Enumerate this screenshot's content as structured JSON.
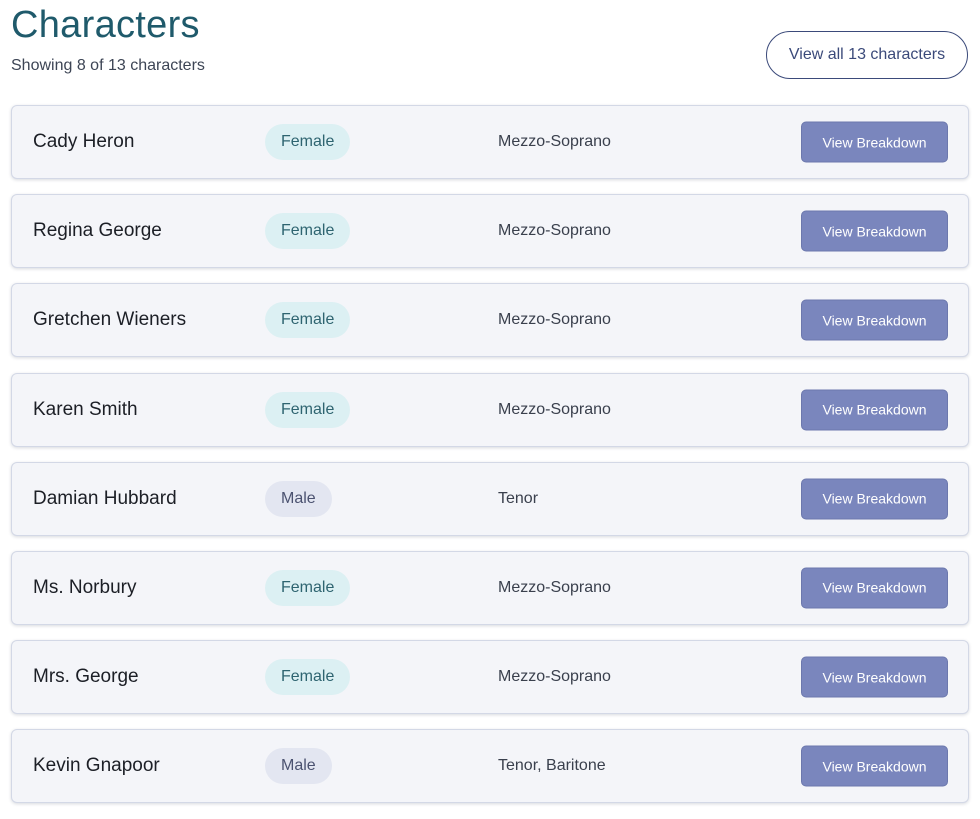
{
  "header": {
    "title": "Characters",
    "subtitle": "Showing 8 of 13 characters",
    "view_all_label": "View all 13 characters"
  },
  "colors": {
    "title": "#1f5a6b",
    "card_background": "#f4f5f9",
    "female_badge_bg": "#dcf0f3",
    "male_badge_bg": "#e3e6f1",
    "breakdown_button_bg": "#7a86bd"
  },
  "characters": [
    {
      "name": "Cady Heron",
      "gender": "Female",
      "voice": "Mezzo-Soprano",
      "action_label": "View Breakdown"
    },
    {
      "name": "Regina George",
      "gender": "Female",
      "voice": "Mezzo-Soprano",
      "action_label": "View Breakdown"
    },
    {
      "name": "Gretchen Wieners",
      "gender": "Female",
      "voice": "Mezzo-Soprano",
      "action_label": "View Breakdown"
    },
    {
      "name": "Karen Smith",
      "gender": "Female",
      "voice": "Mezzo-Soprano",
      "action_label": "View Breakdown"
    },
    {
      "name": "Damian Hubbard",
      "gender": "Male",
      "voice": "Tenor",
      "action_label": "View Breakdown"
    },
    {
      "name": "Ms. Norbury",
      "gender": "Female",
      "voice": "Mezzo-Soprano",
      "action_label": "View Breakdown"
    },
    {
      "name": "Mrs. George",
      "gender": "Female",
      "voice": "Mezzo-Soprano",
      "action_label": "View Breakdown"
    },
    {
      "name": "Kevin Gnapoor",
      "gender": "Male",
      "voice": "Tenor, Baritone",
      "action_label": "View Breakdown"
    }
  ]
}
